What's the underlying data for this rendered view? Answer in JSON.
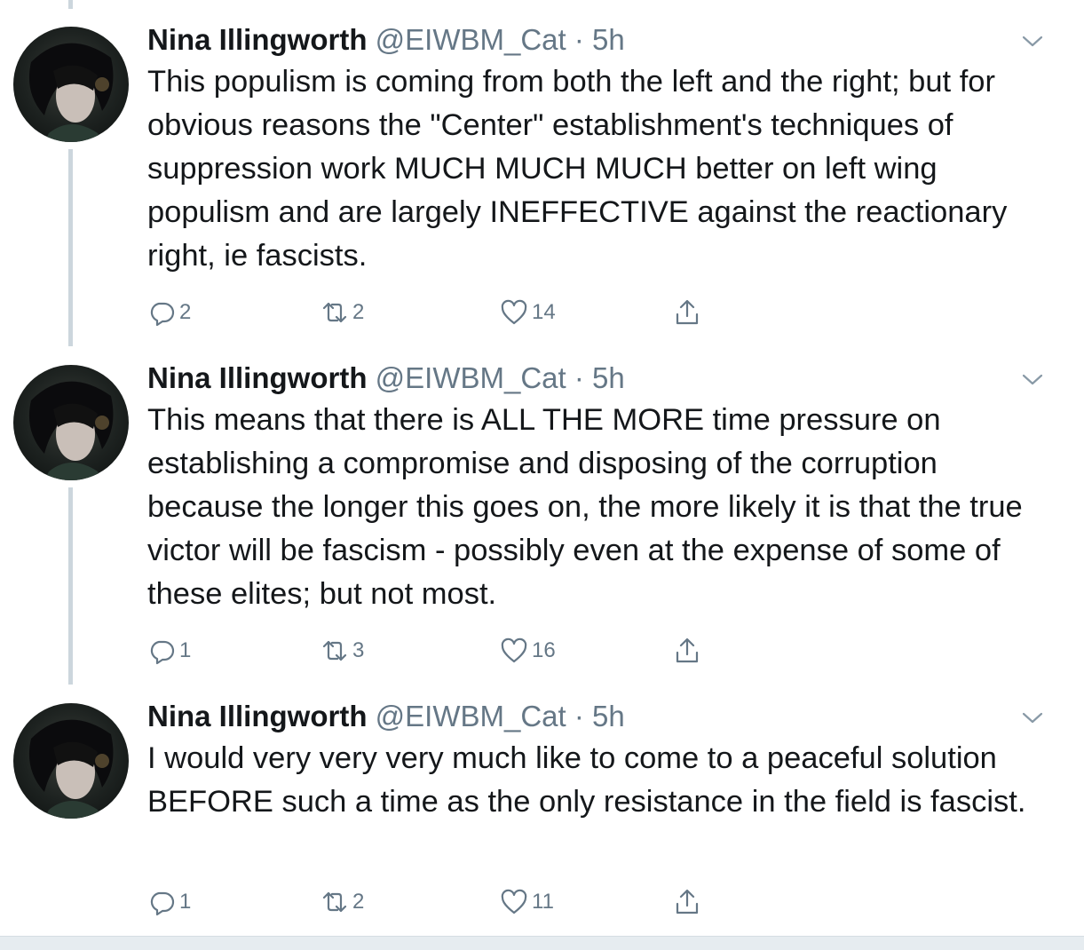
{
  "tweets": [
    {
      "name": "Nina Illingworth",
      "handle": "@EIWBM_Cat",
      "separator": "·",
      "time": "5h",
      "text": "This populism is coming from both the left and the right; but for obvious reasons the \"Center\" establishment's techniques of suppression work MUCH MUCH MUCH better on left wing populism and are largely INEFFECTIVE against the reactionary right, ie fascists.",
      "replies": "2",
      "retweets": "2",
      "likes": "14"
    },
    {
      "name": "Nina Illingworth",
      "handle": "@EIWBM_Cat",
      "separator": "·",
      "time": "5h",
      "text": "This means that there is ALL THE MORE time pressure on establishing a compromise and disposing of the corruption because the longer this goes on, the more likely it is that the true victor will be fascism - possibly even at the expense of some of these elites; but not most.",
      "replies": "1",
      "retweets": "3",
      "likes": "16"
    },
    {
      "name": "Nina Illingworth",
      "handle": "@EIWBM_Cat",
      "separator": "·",
      "time": "5h",
      "text": "I would very very very much like to come to a peaceful solution BEFORE such a time as the only resistance in the field is fascist.",
      "replies": "1",
      "retweets": "2",
      "likes": "11"
    }
  ],
  "icons": {
    "reply": "reply-icon",
    "retweet": "retweet-icon",
    "like": "like-icon",
    "share": "share-icon",
    "menu": "chevron-down-icon"
  },
  "colors": {
    "text": "#14171a",
    "secondary": "#657786",
    "thread_line": "#ccd6dd"
  }
}
